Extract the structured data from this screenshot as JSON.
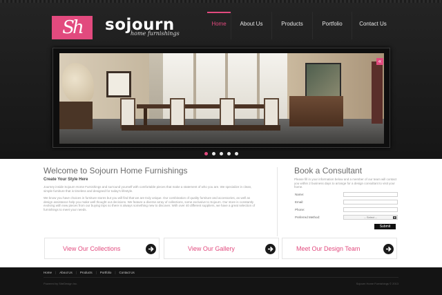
{
  "brand": {
    "monogram": "Sh",
    "name": "sojourn",
    "tagline": "home furnishings",
    "accent_color": "#e24a7e"
  },
  "nav": {
    "items": [
      {
        "label": "Home",
        "active": true
      },
      {
        "label": "About Us",
        "active": false
      },
      {
        "label": "Products",
        "active": false
      },
      {
        "label": "Portfolio",
        "active": false
      },
      {
        "label": "Contact Us",
        "active": false
      }
    ]
  },
  "slider": {
    "icon": "collapse-icon",
    "icon_glyph": "«",
    "dot_count": 5,
    "active_dot": 1
  },
  "welcome": {
    "title": "Welcome to Sojourn Home Furnishings",
    "subtitle": "Create Your Style Here",
    "paragraphs": [
      "Journey inside Sojourn Home Furnishings and surround yourself with comfortable pieces that make a statement of who you are. We specialize in clean, simple furniture that is timeless and designed for today's lifestyle.",
      "We know you have choices in furniture stores but you will find that we are truly unique. Our combination of quality furniture and accessories, as well as design assistance help you make well thought out decisions. We feature a diverse array of collections, some exclusive to Sojourn. Our store is constantly evolving with new pieces from our buying trips so there is always something new to discover. With over 40 different suppliers, we have a great selection of furnishings to meet your needs."
    ]
  },
  "consult": {
    "title": "Book a Consultant",
    "text": "Please fill in your information below and a member of our team will contact you within 2 business days to arrange for a design consultant to visit your home.",
    "fields": [
      {
        "label": "Name:",
        "value": ""
      },
      {
        "label": "Email:",
        "value": ""
      },
      {
        "label": "Phone:",
        "value": ""
      }
    ],
    "method_label": "Preferred Method:",
    "method_value": "-- Select --",
    "submit_label": "Submit"
  },
  "cta": [
    {
      "label": "View Our Collections",
      "icon": "arrow-right-icon"
    },
    {
      "label": "View Our Gallery",
      "icon": "arrow-right-icon"
    },
    {
      "label": "Meet Our Design Team",
      "icon": "arrow-right-icon"
    }
  ],
  "footer": {
    "nav": [
      "Home",
      "About Us",
      "Products",
      "Portfolio",
      "Contact Us"
    ],
    "left": "Powered by SiteDesign Inc.",
    "right": "Sojourn Home Furnishings © 2013"
  }
}
